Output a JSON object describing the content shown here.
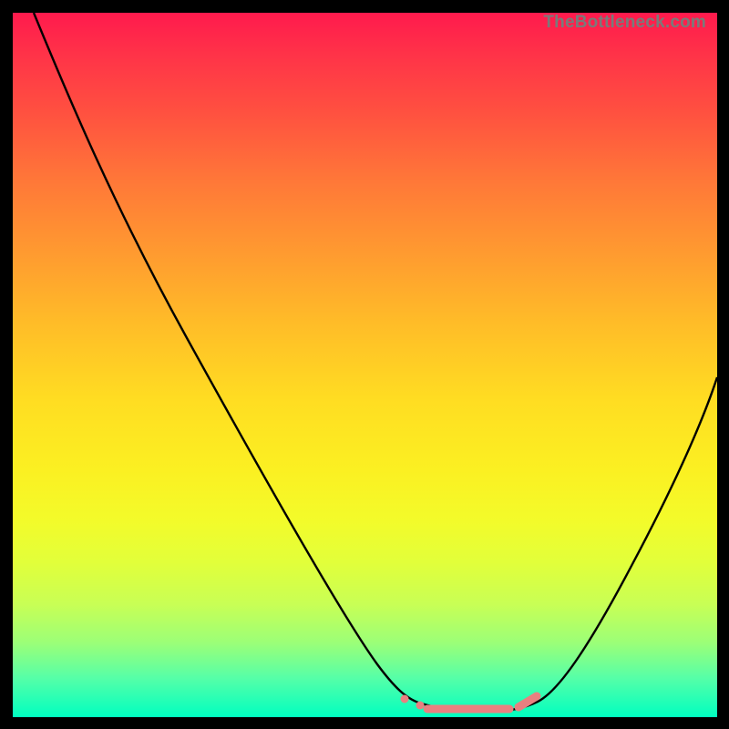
{
  "watermark": "TheBottleneck.com",
  "chart_data": {
    "type": "line",
    "title": "",
    "xlabel": "",
    "ylabel": "",
    "xlim": [
      0,
      1
    ],
    "ylim": [
      0,
      1
    ],
    "series": [
      {
        "name": "curve",
        "x": [
          0.03,
          0.08,
          0.15,
          0.25,
          0.35,
          0.45,
          0.52,
          0.555,
          0.59,
          0.64,
          0.7,
          0.74,
          0.78,
          0.84,
          0.9,
          0.96,
          1.0
        ],
        "y": [
          1.0,
          0.88,
          0.73,
          0.54,
          0.36,
          0.18,
          0.07,
          0.025,
          0.01,
          0.005,
          0.005,
          0.012,
          0.03,
          0.1,
          0.22,
          0.37,
          0.48
        ]
      },
      {
        "name": "flat-marker",
        "x": [
          0.555,
          0.58,
          0.63,
          0.68,
          0.72,
          0.74
        ],
        "y": [
          0.025,
          0.012,
          0.006,
          0.006,
          0.012,
          0.018
        ]
      }
    ],
    "annotations": [],
    "background_gradient": {
      "top": "#ff1a4d",
      "mid": "#ffdd22",
      "bottom": "#00ffc0"
    }
  }
}
